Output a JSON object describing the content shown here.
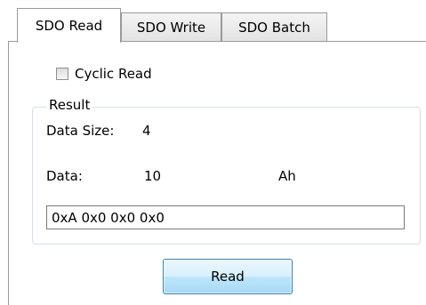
{
  "tabs": [
    {
      "label": "SDO Read",
      "active": true
    },
    {
      "label": "SDO Write",
      "active": false
    },
    {
      "label": "SDO Batch",
      "active": false
    }
  ],
  "cyclic_read": {
    "label": "Cyclic Read",
    "checked": false
  },
  "result": {
    "group_label": "Result",
    "data_size_label": "Data Size:",
    "data_size_value": "4",
    "data_label": "Data:",
    "data_value": "10",
    "data_unit": "Ah",
    "raw_bytes": "0xA 0x0 0x0 0x0"
  },
  "read_button": {
    "label": "Read"
  },
  "colors": {
    "button_border": "#3c7fb1",
    "button_fill": "#bee6fd",
    "group_border": "#d5dfe5"
  }
}
